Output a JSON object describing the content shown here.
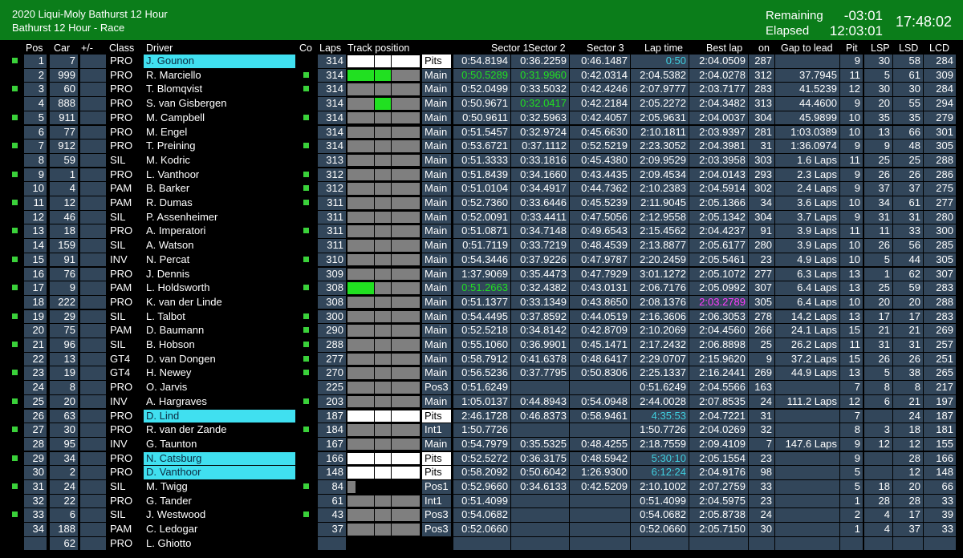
{
  "event": {
    "title": "2020 Liqui-Moly Bathurst 12 Hour",
    "session": "Bathurst 12 Hour - Race",
    "remaining_label": "Remaining",
    "remaining_value": "-03:01",
    "elapsed_label": "Elapsed",
    "elapsed_value": "12:03:01",
    "clock": "17:48:02"
  },
  "columns": {
    "pos": "Pos",
    "car": "Car",
    "plusminus": "+/-",
    "class": "Class",
    "driver": "Driver",
    "co": "Co",
    "laps": "Laps",
    "track": "Track position",
    "s1": "Sector 1",
    "s2": "Sector 2",
    "s3": "Sector 3",
    "lap": "Lap time",
    "best": "Best lap",
    "on": "on",
    "gap": "Gap to lead",
    "pit": "Pit",
    "lsp": "LSP",
    "lsd": "LSD",
    "lcd": "LCD"
  },
  "colors": {
    "header_bg": "#0b7d1a",
    "cell_bg": "#32465a",
    "highlight_cyan": "#40e0f0",
    "sector_green": "#21e021",
    "laptime_cyan": "#40d0e0",
    "overall_best_magenta": "#ff3cff",
    "flag_green": "#3ad13a"
  },
  "rows": [
    {
      "pos": "1",
      "car": "7",
      "class": "PRO",
      "driver": "J. Gounon",
      "hl": true,
      "co": false,
      "laps": "314",
      "track": [
        "w",
        "w",
        "w"
      ],
      "status": "Pits",
      "s1": "0:54.8194",
      "s2": "0:36.2259",
      "s3": "0:46.1487",
      "lap": "0:50",
      "lapc": "cyan",
      "best": "2:04.0509",
      "on": "287",
      "gap": "",
      "pit": "9",
      "lsp": "30",
      "lsd": "58",
      "lcd": "284"
    },
    {
      "pos": "2",
      "car": "999",
      "class": "PRO",
      "driver": "R. Marciello",
      "hl": false,
      "co": true,
      "laps": "314",
      "track": [
        "gr",
        "gr",
        "g"
      ],
      "status": "Main",
      "s1": "0:50.5289",
      "s1c": "green",
      "s2": "0:31.9960",
      "s2c": "green",
      "s3": "0:42.0314",
      "lap": "2:04.5382",
      "best": "2:04.0278",
      "on": "312",
      "gap": "37.7945",
      "pit": "11",
      "lsp": "5",
      "lsd": "61",
      "lcd": "309"
    },
    {
      "pos": "3",
      "car": "60",
      "class": "PRO",
      "driver": "T. Blomqvist",
      "hl": false,
      "co": true,
      "laps": "314",
      "track": [
        "g",
        "g",
        "g"
      ],
      "status": "Main",
      "s1": "0:52.0499",
      "s2": "0:33.5032",
      "s3": "0:42.4246",
      "lap": "2:07.9777",
      "best": "2:03.7177",
      "on": "283",
      "gap": "41.5239",
      "pit": "12",
      "lsp": "30",
      "lsd": "30",
      "lcd": "284"
    },
    {
      "pos": "4",
      "car": "888",
      "class": "PRO",
      "driver": "S. van Gisbergen",
      "hl": false,
      "co": false,
      "laps": "314",
      "track": [
        "g",
        "gr",
        "g"
      ],
      "status": "Main",
      "s1": "0:50.9671",
      "s2": "0:32.0417",
      "s2c": "green",
      "s3": "0:42.2184",
      "lap": "2:05.2272",
      "best": "2:04.3482",
      "on": "313",
      "gap": "44.4600",
      "pit": "9",
      "lsp": "20",
      "lsd": "55",
      "lcd": "294"
    },
    {
      "pos": "5",
      "car": "911",
      "class": "PRO",
      "driver": "M. Campbell",
      "hl": false,
      "co": true,
      "laps": "314",
      "track": [
        "g",
        "g",
        "g"
      ],
      "status": "Main",
      "s1": "0:50.9611",
      "s2": "0:32.5963",
      "s3": "0:42.4057",
      "lap": "2:05.9631",
      "best": "2:04.0037",
      "on": "304",
      "gap": "45.9899",
      "pit": "10",
      "lsp": "35",
      "lsd": "35",
      "lcd": "279"
    },
    {
      "pos": "6",
      "car": "77",
      "class": "PRO",
      "driver": "M. Engel",
      "hl": false,
      "co": false,
      "laps": "314",
      "track": [
        "g",
        "g",
        "g"
      ],
      "status": "Main",
      "s1": "0:51.5457",
      "s2": "0:32.9724",
      "s3": "0:45.6630",
      "lap": "2:10.1811",
      "best": "2:03.9397",
      "on": "281",
      "gap": "1:03.0389",
      "pit": "10",
      "lsp": "13",
      "lsd": "66",
      "lcd": "301"
    },
    {
      "pos": "7",
      "car": "912",
      "class": "PRO",
      "driver": "T. Preining",
      "hl": false,
      "co": true,
      "laps": "314",
      "track": [
        "g",
        "g",
        "g"
      ],
      "status": "Main",
      "s1": "0:53.6721",
      "s2": "0:37.1112",
      "s3": "0:52.5219",
      "lap": "2:23.3052",
      "best": "2:04.3981",
      "on": "31",
      "gap": "1:36.0974",
      "pit": "9",
      "lsp": "9",
      "lsd": "48",
      "lcd": "305"
    },
    {
      "pos": "8",
      "car": "59",
      "class": "SIL",
      "driver": "M. Kodric",
      "hl": false,
      "co": false,
      "laps": "313",
      "track": [
        "g",
        "g",
        "g"
      ],
      "status": "Main",
      "s1": "0:51.3333",
      "s2": "0:33.1816",
      "s3": "0:45.4380",
      "lap": "2:09.9529",
      "best": "2:03.3958",
      "on": "303",
      "gap": "1.6 Laps",
      "pit": "11",
      "lsp": "25",
      "lsd": "25",
      "lcd": "288"
    },
    {
      "pos": "9",
      "car": "1",
      "class": "PRO",
      "driver": "L. Vanthoor",
      "hl": false,
      "co": true,
      "laps": "312",
      "track": [
        "g",
        "g",
        "g"
      ],
      "status": "Main",
      "s1": "0:51.8439",
      "s2": "0:34.1660",
      "s3": "0:43.4435",
      "lap": "2:09.4534",
      "best": "2:04.0143",
      "on": "293",
      "gap": "2.3 Laps",
      "pit": "9",
      "lsp": "26",
      "lsd": "26",
      "lcd": "286"
    },
    {
      "pos": "10",
      "car": "4",
      "class": "PAM",
      "driver": "B. Barker",
      "hl": false,
      "co": true,
      "laps": "312",
      "track": [
        "g",
        "g",
        "g"
      ],
      "status": "Main",
      "s1": "0:51.0104",
      "s2": "0:34.4917",
      "s3": "0:44.7362",
      "lap": "2:10.2383",
      "best": "2:04.5914",
      "on": "302",
      "gap": "2.4 Laps",
      "pit": "9",
      "lsp": "37",
      "lsd": "37",
      "lcd": "275"
    },
    {
      "pos": "11",
      "car": "12",
      "class": "PAM",
      "driver": "R. Dumas",
      "hl": false,
      "co": true,
      "laps": "311",
      "track": [
        "g",
        "g",
        "g"
      ],
      "status": "Main",
      "s1": "0:52.7360",
      "s2": "0:33.6446",
      "s3": "0:45.5239",
      "lap": "2:11.9045",
      "best": "2:05.1366",
      "on": "34",
      "gap": "3.6 Laps",
      "pit": "10",
      "lsp": "34",
      "lsd": "61",
      "lcd": "277"
    },
    {
      "pos": "12",
      "car": "46",
      "class": "SIL",
      "driver": "P. Assenheimer",
      "hl": false,
      "co": false,
      "laps": "311",
      "track": [
        "g",
        "g",
        "g"
      ],
      "status": "Main",
      "s1": "0:52.0091",
      "s2": "0:33.4411",
      "s3": "0:47.5056",
      "lap": "2:12.9558",
      "best": "2:05.1342",
      "on": "304",
      "gap": "3.7 Laps",
      "pit": "9",
      "lsp": "31",
      "lsd": "31",
      "lcd": "280"
    },
    {
      "pos": "13",
      "car": "18",
      "class": "PRO",
      "driver": "A. Imperatori",
      "hl": false,
      "co": true,
      "laps": "311",
      "track": [
        "g",
        "g",
        "g"
      ],
      "status": "Main",
      "s1": "0:51.0871",
      "s2": "0:34.7148",
      "s3": "0:49.6543",
      "lap": "2:15.4562",
      "best": "2:04.4237",
      "on": "91",
      "gap": "3.9 Laps",
      "pit": "11",
      "lsp": "11",
      "lsd": "33",
      "lcd": "300"
    },
    {
      "pos": "14",
      "car": "159",
      "class": "SIL",
      "driver": "A. Watson",
      "hl": false,
      "co": false,
      "laps": "311",
      "track": [
        "g",
        "g",
        "g"
      ],
      "status": "Main",
      "s1": "0:51.7119",
      "s2": "0:33.7219",
      "s3": "0:48.4539",
      "lap": "2:13.8877",
      "best": "2:05.6177",
      "on": "280",
      "gap": "3.9 Laps",
      "pit": "10",
      "lsp": "26",
      "lsd": "56",
      "lcd": "285"
    },
    {
      "pos": "15",
      "car": "91",
      "class": "INV",
      "driver": "N. Percat",
      "hl": false,
      "co": true,
      "laps": "310",
      "track": [
        "g",
        "g",
        "g"
      ],
      "status": "Main",
      "s1": "0:54.3446",
      "s2": "0:37.9226",
      "s3": "0:47.9787",
      "lap": "2:20.2459",
      "best": "2:05.5461",
      "on": "23",
      "gap": "4.9 Laps",
      "pit": "10",
      "lsp": "5",
      "lsd": "44",
      "lcd": "305"
    },
    {
      "pos": "16",
      "car": "76",
      "class": "PRO",
      "driver": "J. Dennis",
      "hl": false,
      "co": false,
      "laps": "309",
      "track": [
        "g",
        "g",
        "g"
      ],
      "status": "Main",
      "s1": "1:37.9069",
      "s2": "0:35.4473",
      "s3": "0:47.7929",
      "lap": "3:01.1272",
      "best": "2:05.1072",
      "on": "277",
      "gap": "6.3 Laps",
      "pit": "13",
      "lsp": "1",
      "lsd": "62",
      "lcd": "307"
    },
    {
      "pos": "17",
      "car": "9",
      "class": "PAM",
      "driver": "L. Holdsworth",
      "hl": false,
      "co": true,
      "laps": "308",
      "track": [
        "gr",
        "g",
        "g"
      ],
      "status": "Main",
      "s1": "0:51.2663",
      "s1c": "green",
      "s2": "0:32.4382",
      "s3": "0:43.0131",
      "lap": "2:06.7176",
      "best": "2:05.0992",
      "on": "307",
      "gap": "6.4 Laps",
      "pit": "13",
      "lsp": "25",
      "lsd": "59",
      "lcd": "283"
    },
    {
      "pos": "18",
      "car": "222",
      "class": "PRO",
      "driver": "K. van der Linde",
      "hl": false,
      "co": false,
      "laps": "308",
      "track": [
        "g",
        "g",
        "g"
      ],
      "status": "Main",
      "s1": "0:51.1377",
      "s2": "0:33.1349",
      "s3": "0:43.8650",
      "lap": "2:08.1376",
      "best": "2:03.2789",
      "bestc": "magenta",
      "on": "305",
      "gap": "6.4 Laps",
      "pit": "10",
      "lsp": "20",
      "lsd": "20",
      "lcd": "288"
    },
    {
      "pos": "19",
      "car": "29",
      "class": "SIL",
      "driver": "L. Talbot",
      "hl": false,
      "co": true,
      "laps": "300",
      "track": [
        "g",
        "g",
        "g"
      ],
      "status": "Main",
      "s1": "0:54.4495",
      "s2": "0:37.8592",
      "s3": "0:44.0519",
      "lap": "2:16.3606",
      "best": "2:06.3053",
      "on": "278",
      "gap": "14.2 Laps",
      "pit": "13",
      "lsp": "17",
      "lsd": "17",
      "lcd": "283"
    },
    {
      "pos": "20",
      "car": "75",
      "class": "PAM",
      "driver": "D. Baumann",
      "hl": false,
      "co": true,
      "laps": "290",
      "track": [
        "g",
        "g",
        "g"
      ],
      "status": "Main",
      "s1": "0:52.5218",
      "s2": "0:34.8142",
      "s3": "0:42.8709",
      "lap": "2:10.2069",
      "best": "2:04.4560",
      "on": "266",
      "gap": "24.1 Laps",
      "pit": "15",
      "lsp": "21",
      "lsd": "21",
      "lcd": "269"
    },
    {
      "pos": "21",
      "car": "96",
      "class": "SIL",
      "driver": "B. Hobson",
      "hl": false,
      "co": true,
      "laps": "288",
      "track": [
        "g",
        "g",
        "g"
      ],
      "status": "Main",
      "s1": "0:55.1060",
      "s2": "0:36.9901",
      "s3": "0:45.1471",
      "lap": "2:17.2432",
      "best": "2:06.8898",
      "on": "25",
      "gap": "26.2 Laps",
      "pit": "11",
      "lsp": "31",
      "lsd": "31",
      "lcd": "257"
    },
    {
      "pos": "22",
      "car": "13",
      "class": "GT4",
      "driver": "D. van Dongen",
      "hl": false,
      "co": true,
      "laps": "277",
      "track": [
        "g",
        "g",
        "g"
      ],
      "status": "Main",
      "s1": "0:58.7912",
      "s2": "0:41.6378",
      "s3": "0:48.6417",
      "lap": "2:29.0707",
      "best": "2:15.9620",
      "on": "9",
      "gap": "37.2 Laps",
      "pit": "15",
      "lsp": "26",
      "lsd": "26",
      "lcd": "251"
    },
    {
      "pos": "23",
      "car": "19",
      "class": "GT4",
      "driver": "H. Newey",
      "hl": false,
      "co": true,
      "laps": "270",
      "track": [
        "g",
        "g",
        "g"
      ],
      "status": "Main",
      "s1": "0:56.5236",
      "s2": "0:37.7795",
      "s3": "0:50.8306",
      "lap": "2:25.1337",
      "best": "2:16.2441",
      "on": "269",
      "gap": "44.9 Laps",
      "pit": "13",
      "lsp": "5",
      "lsd": "38",
      "lcd": "265"
    },
    {
      "pos": "24",
      "car": "8",
      "class": "PRO",
      "driver": "O. Jarvis",
      "hl": false,
      "co": false,
      "laps": "225",
      "track": [
        "g",
        "g",
        "g"
      ],
      "status": "Pos3",
      "s1": "0:51.6249",
      "s2": "",
      "s3": "",
      "lap": "0:51.6249",
      "best": "2:04.5566",
      "on": "163",
      "gap": "",
      "pit": "7",
      "lsp": "8",
      "lsd": "8",
      "lcd": "217"
    },
    {
      "pos": "25",
      "car": "20",
      "class": "INV",
      "driver": "A. Hargraves",
      "hl": false,
      "co": true,
      "laps": "203",
      "track": [
        "g",
        "g",
        "g"
      ],
      "status": "Main",
      "s1": "1:05.0137",
      "s2": "0:44.8943",
      "s3": "0:54.0948",
      "lap": "2:44.0028",
      "best": "2:07.8535",
      "on": "24",
      "gap": "111.2 Laps",
      "pit": "12",
      "lsp": "6",
      "lsd": "21",
      "lcd": "197"
    },
    {
      "pos": "26",
      "car": "63",
      "class": "PRO",
      "driver": "D. Lind",
      "hl": true,
      "co": false,
      "laps": "187",
      "track": [
        "w",
        "w",
        "w"
      ],
      "status": "Pits",
      "s1": "2:46.1728",
      "s2": "0:46.8373",
      "s3": "0:58.9461",
      "lap": "4:35:53",
      "lapc": "cyan",
      "best": "2:04.7221",
      "on": "31",
      "gap": "",
      "pit": "7",
      "lsp": "",
      "lsd": "24",
      "lcd": "187"
    },
    {
      "pos": "27",
      "car": "30",
      "class": "PRO",
      "driver": "R. van der Zande",
      "hl": false,
      "co": true,
      "laps": "184",
      "track": [
        "g",
        "g",
        "g"
      ],
      "status": "Int1",
      "s1": "1:50.7726",
      "s2": "",
      "s3": "",
      "lap": "1:50.7726",
      "best": "2:04.0269",
      "on": "32",
      "gap": "",
      "pit": "8",
      "lsp": "3",
      "lsd": "18",
      "lcd": "181"
    },
    {
      "pos": "28",
      "car": "95",
      "class": "INV",
      "driver": "G. Taunton",
      "hl": false,
      "co": false,
      "laps": "167",
      "track": [
        "g",
        "g",
        "g"
      ],
      "status": "Main",
      "s1": "0:54.7979",
      "s2": "0:35.5325",
      "s3": "0:48.4255",
      "lap": "2:18.7559",
      "best": "2:09.4109",
      "on": "7",
      "gap": "147.6 Laps",
      "pit": "9",
      "lsp": "12",
      "lsd": "12",
      "lcd": "155"
    },
    {
      "pos": "29",
      "car": "34",
      "class": "PRO",
      "driver": "N. Catsburg",
      "hl": true,
      "co": false,
      "laps": "166",
      "track": [
        "w",
        "w",
        "w"
      ],
      "status": "Pits",
      "s1": "0:52.5272",
      "s2": "0:36.3175",
      "s3": "0:48.5942",
      "lap": "5:30:10",
      "lapc": "cyan",
      "best": "2:05.1554",
      "on": "23",
      "gap": "",
      "pit": "9",
      "lsp": "",
      "lsd": "28",
      "lcd": "166"
    },
    {
      "pos": "30",
      "car": "2",
      "class": "PRO",
      "driver": "D. Vanthoor",
      "hl": true,
      "co": false,
      "laps": "148",
      "track": [
        "w",
        "w",
        "w"
      ],
      "status": "Pits",
      "s1": "0:58.2092",
      "s2": "0:50.6042",
      "s3": "1:26.9300",
      "lap": "6:12:24",
      "lapc": "cyan",
      "best": "2:04.9176",
      "on": "98",
      "gap": "",
      "pit": "5",
      "lsp": "",
      "lsd": "12",
      "lcd": "148"
    },
    {
      "pos": "31",
      "car": "24",
      "class": "SIL",
      "driver": "M. Twigg",
      "hl": false,
      "co": true,
      "laps": "84",
      "track": [
        "g0",
        "",
        ""
      ],
      "status": "Pos1",
      "s1": "0:52.9660",
      "s2": "0:34.6133",
      "s3": "0:42.5209",
      "lap": "2:10.1002",
      "best": "2:07.2759",
      "on": "33",
      "gap": "",
      "pit": "5",
      "lsp": "18",
      "lsd": "20",
      "lcd": "66"
    },
    {
      "pos": "32",
      "car": "22",
      "class": "PRO",
      "driver": "G. Tander",
      "hl": false,
      "co": false,
      "laps": "61",
      "track": [
        "g",
        "g",
        "g"
      ],
      "status": "Int1",
      "s1": "0:51.4099",
      "s2": "",
      "s3": "",
      "lap": "0:51.4099",
      "best": "2:04.5975",
      "on": "23",
      "gap": "",
      "pit": "1",
      "lsp": "28",
      "lsd": "28",
      "lcd": "33"
    },
    {
      "pos": "33",
      "car": "6",
      "class": "SIL",
      "driver": "J. Westwood",
      "hl": false,
      "co": true,
      "laps": "43",
      "track": [
        "g",
        "g",
        "g"
      ],
      "status": "Pos3",
      "s1": "0:54.0682",
      "s2": "",
      "s3": "",
      "lap": "0:54.0682",
      "best": "2:05.8738",
      "on": "24",
      "gap": "",
      "pit": "2",
      "lsp": "4",
      "lsd": "17",
      "lcd": "39"
    },
    {
      "pos": "34",
      "car": "188",
      "class": "PAM",
      "driver": "C. Ledogar",
      "hl": false,
      "co": false,
      "laps": "37",
      "track": [
        "g",
        "g",
        "g"
      ],
      "status": "Pos3",
      "s1": "0:52.0660",
      "s2": "",
      "s3": "",
      "lap": "0:52.0660",
      "best": "2:05.7150",
      "on": "30",
      "gap": "",
      "pit": "1",
      "lsp": "4",
      "lsd": "37",
      "lcd": "33"
    },
    {
      "pos": "",
      "car": "62",
      "class": "PRO",
      "driver": "L. Ghiotto",
      "hl": false,
      "co": false,
      "laps": "",
      "track": [
        "",
        "",
        ""
      ],
      "status": "",
      "s1": "",
      "s2": "",
      "s3": "",
      "lap": "",
      "best": "",
      "on": "",
      "gap": "",
      "pit": "",
      "lsp": "",
      "lsd": "",
      "lcd": ""
    }
  ]
}
